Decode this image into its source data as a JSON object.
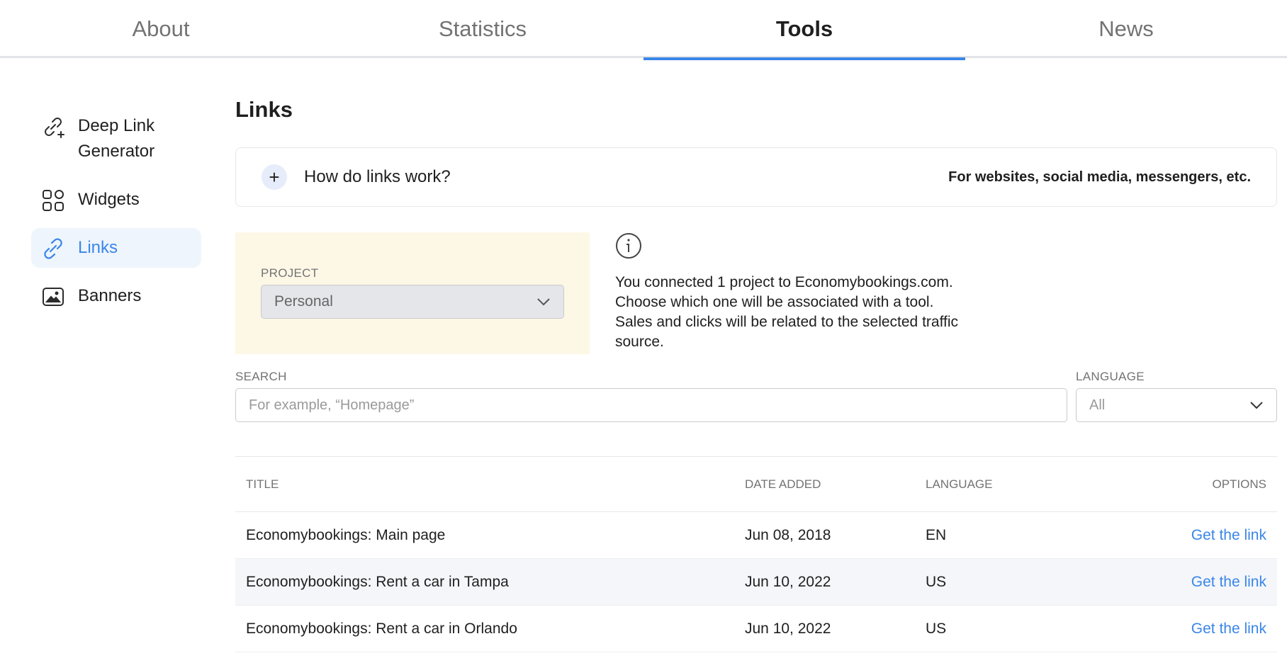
{
  "tabs": [
    {
      "label": "About",
      "active": false
    },
    {
      "label": "Statistics",
      "active": false
    },
    {
      "label": "Tools",
      "active": true
    },
    {
      "label": "News",
      "active": false
    }
  ],
  "sidebar": {
    "items": [
      {
        "label": "Deep Link Generator",
        "icon": "link-plus-icon",
        "active": false
      },
      {
        "label": "Widgets",
        "icon": "widgets-grid-icon",
        "active": false
      },
      {
        "label": "Links",
        "icon": "link-icon",
        "active": true
      },
      {
        "label": "Banners",
        "icon": "image-icon",
        "active": false
      }
    ]
  },
  "main": {
    "title": "Links",
    "accordion": {
      "title": "How do links work?",
      "note": "For websites, social media, messengers, etc.",
      "icon": "plus-icon"
    },
    "project": {
      "label": "PROJECT",
      "value": "Personal"
    },
    "info": {
      "icon": "info-icon",
      "lines": [
        "You connected 1 project to Economybookings.com.",
        "Choose which one will be associated with a tool.",
        "Sales and clicks will be related to the selected traffic",
        "source."
      ]
    },
    "search": {
      "label": "SEARCH",
      "placeholder": "For example, “Homepage”"
    },
    "language": {
      "label": "LANGUAGE",
      "value": "All"
    },
    "table": {
      "headers": [
        "TITLE",
        "DATE ADDED",
        "LANGUAGE",
        "OPTIONS"
      ],
      "rows": [
        {
          "title": "Economybookings: Main page",
          "date": "Jun 08, 2018",
          "language": "EN",
          "option": "Get the link"
        },
        {
          "title": "Economybookings: Rent a car in Tampa",
          "date": "Jun 10, 2022",
          "language": "US",
          "option": "Get the link"
        },
        {
          "title": "Economybookings: Rent a car in Orlando",
          "date": "Jun 10, 2022",
          "language": "US",
          "option": "Get the link"
        }
      ]
    }
  },
  "colors": {
    "accent": "#3a86e8",
    "project_bg": "#fdf7e6",
    "active_item_bg": "#eef5fd"
  }
}
